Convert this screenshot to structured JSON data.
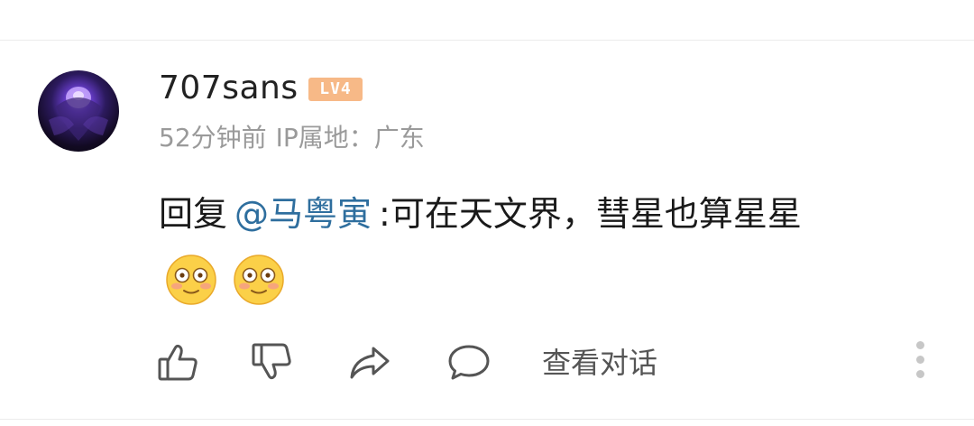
{
  "comment": {
    "username": "707sans",
    "level_badge": "LV4",
    "time_ago": "52分钟前",
    "ip_location": "IP属地：广东",
    "reply_prefix": "回复",
    "mention": "@马粤寅",
    "text": ":可在天文界，彗星也算星星",
    "emojis": [
      "flushed-face",
      "flushed-face"
    ]
  },
  "actions": {
    "like_icon": "thumbs-up-icon",
    "dislike_icon": "thumbs-down-icon",
    "share_icon": "share-arrow-icon",
    "comment_icon": "speech-bubble-icon",
    "view_conversation_label": "查看对话",
    "more_icon": "vertical-ellipsis-icon"
  },
  "colors": {
    "username": "#222222",
    "meta": "#9a9a9a",
    "mention": "#2e6e9e",
    "badge": "#f7b987",
    "icon_stroke": "#555555"
  }
}
